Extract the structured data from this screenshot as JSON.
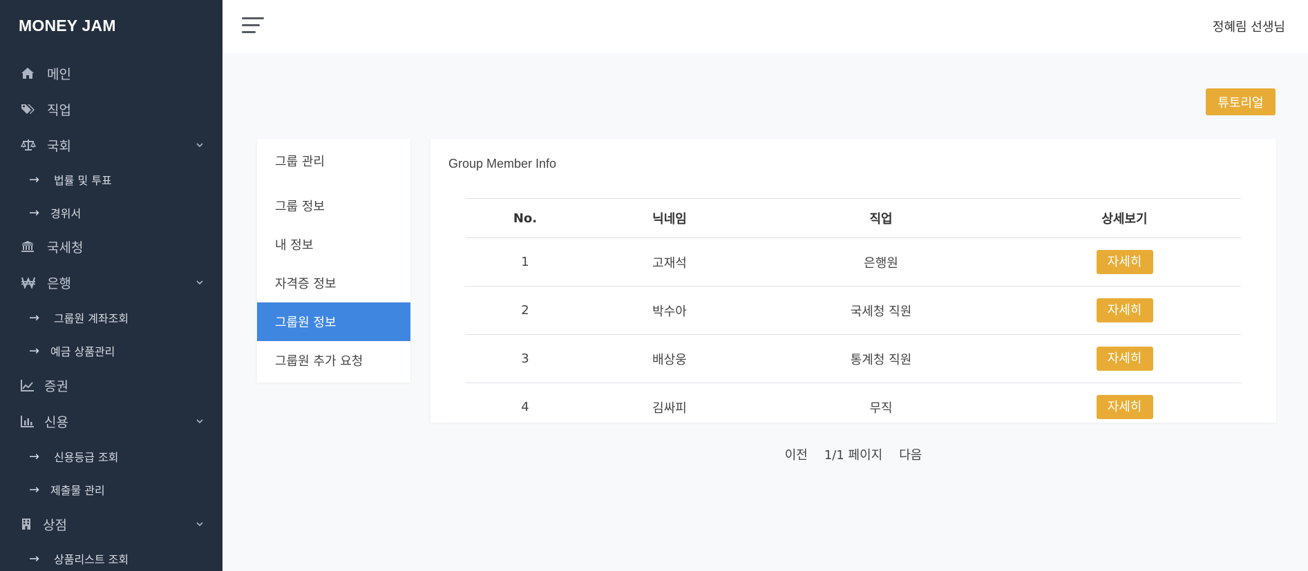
{
  "brand": "MONEY JAM",
  "sidebar": {
    "items": [
      {
        "label": "메인",
        "icon": "home-icon"
      },
      {
        "label": "직업",
        "icon": "tags-icon"
      },
      {
        "label": "국회",
        "icon": "balance-scale-icon",
        "expanded": true
      },
      {
        "label": "국세청",
        "icon": "bank-icon"
      },
      {
        "label": "은행",
        "icon": "won-icon",
        "expanded": true
      },
      {
        "label": "증권",
        "icon": "line-chart-icon"
      },
      {
        "label": "신용",
        "icon": "bar-chart-icon",
        "expanded": true
      },
      {
        "label": "상점",
        "icon": "building-icon",
        "expanded": true
      }
    ],
    "subitems": {
      "assembly": [
        "법률 및 투표",
        "경위서"
      ],
      "bank": [
        "그룹원 계좌조회",
        "예금 상품관리"
      ],
      "credit": [
        "신용등급 조회",
        "제출물 관리"
      ],
      "store": [
        "상품리스트 조회"
      ]
    },
    "arrow": "→"
  },
  "header": {
    "user": "정혜림 선생님"
  },
  "tutorial_label": "튜토리얼",
  "group_menu": {
    "items": [
      "그룹 관리",
      "그룹 정보",
      "내 정보",
      "자격증 정보",
      "그룹원 정보",
      "그룹원 추가 요청"
    ],
    "active_item": "그룹원 정보"
  },
  "card": {
    "title": "Group Member Info",
    "columns": [
      "No.",
      "닉네임",
      "직업",
      "상세보기"
    ],
    "rows": [
      {
        "no": "1",
        "nickname": "고재석",
        "job": "은행원",
        "action": "자세히"
      },
      {
        "no": "2",
        "nickname": "박수아",
        "job": "국세청 직원",
        "action": "자세히"
      },
      {
        "no": "3",
        "nickname": "배상웅",
        "job": "통계청 직원",
        "action": "자세히"
      },
      {
        "no": "4",
        "nickname": "김싸피",
        "job": "무직",
        "action": "자세히"
      }
    ],
    "pager": {
      "prev": "이전",
      "page": "1/1 페이지",
      "next": "다음"
    }
  },
  "colors": {
    "sidebar_bg": "#232e3e",
    "accent_active": "#3f86e0",
    "button_orange": "#e8ac36"
  }
}
